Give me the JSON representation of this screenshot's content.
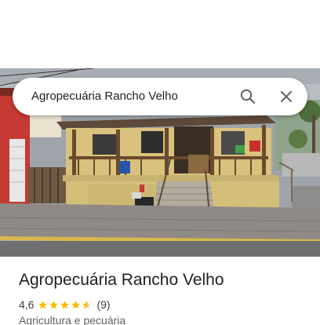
{
  "search": {
    "query": "Agropecuária Rancho Velho"
  },
  "place": {
    "name": "Agropecuária Rancho Velho",
    "rating": "4,6",
    "rating_value": 4.6,
    "review_count": "(9)",
    "category": "Agricultura e pecuária"
  },
  "colors": {
    "star": "#fbbc04",
    "star_empty": "#dadce0",
    "icon": "#5f6368"
  },
  "icons": {
    "search": "search-icon",
    "close": "close-icon",
    "star": "star-icon"
  }
}
